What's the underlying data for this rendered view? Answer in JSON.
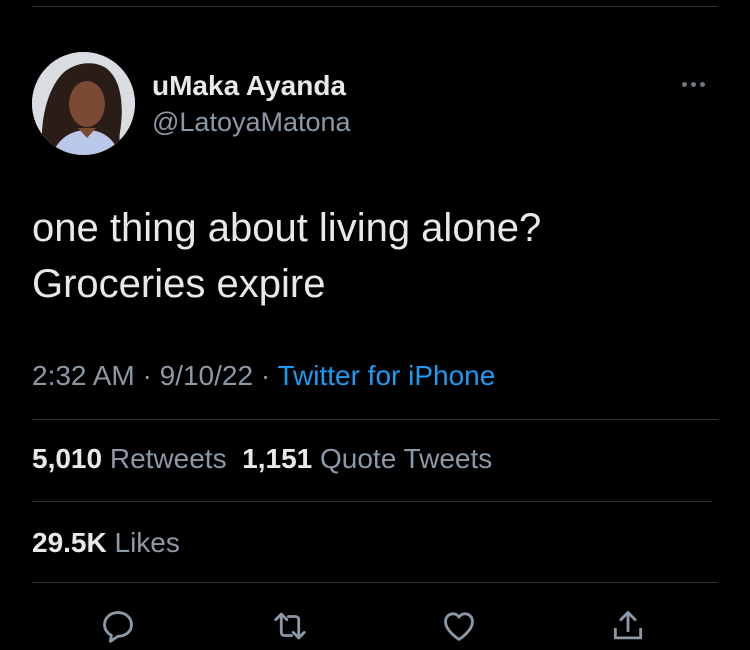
{
  "tweet": {
    "author": {
      "display_name": "uMaka Ayanda",
      "handle": "@LatoyaMatona"
    },
    "text_lines": [
      "one thing about living alone?",
      "Groceries expire"
    ],
    "time": "2:32 AM",
    "sep1": "·",
    "date": "9/10/22",
    "sep2": "·",
    "source": "Twitter for iPhone",
    "stats": {
      "retweets_count": "5,010",
      "retweets_label": "Retweets",
      "quotes_count": "1,151",
      "quotes_label": "Quote Tweets",
      "likes_count": "29.5K",
      "likes_label": "Likes"
    }
  },
  "icons": [
    "more-icon",
    "reply-icon",
    "retweet-icon",
    "like-icon",
    "share-icon"
  ],
  "colors": {
    "background": "#000000",
    "primary_text": "#e7e9ea",
    "secondary_text": "#8b98a5",
    "link": "#1d9bf0",
    "divider": "#2f3336"
  }
}
